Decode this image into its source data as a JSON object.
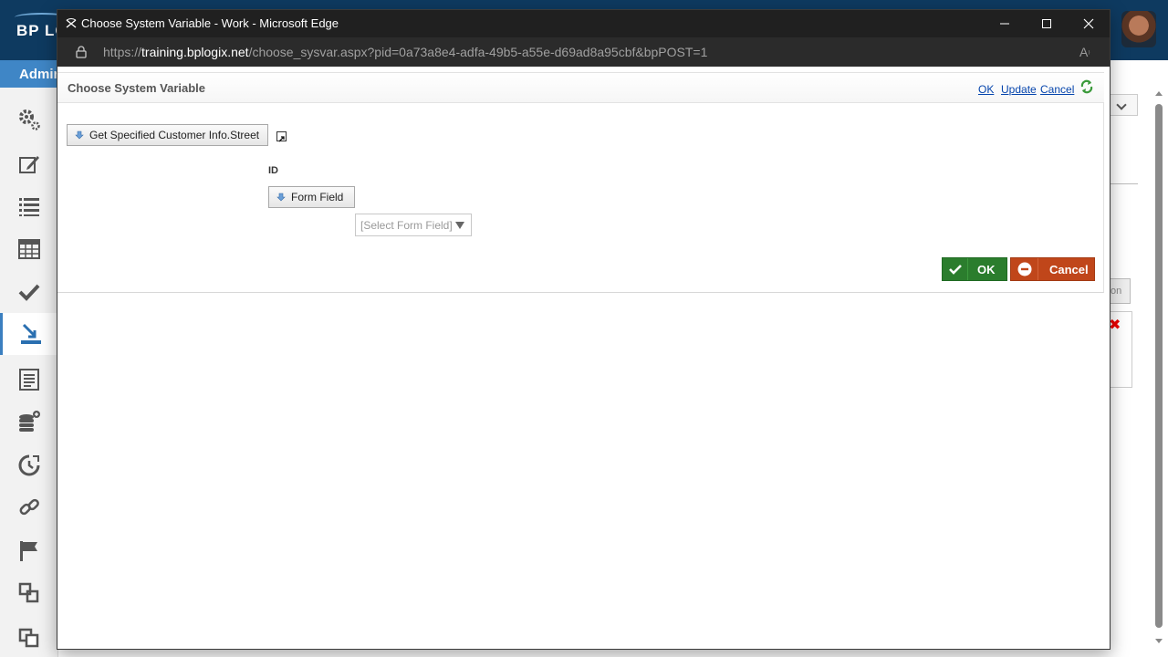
{
  "app": {
    "logo_text": "BP LO",
    "admin_tab_label": "Admir"
  },
  "sidebar": {
    "items": [
      {
        "icon": "gears-icon"
      },
      {
        "icon": "edit-icon"
      },
      {
        "icon": "list-icon"
      },
      {
        "icon": "table-icon"
      },
      {
        "icon": "check-icon"
      },
      {
        "icon": "import-icon",
        "active": true
      },
      {
        "icon": "report-icon"
      },
      {
        "icon": "database-add-icon"
      },
      {
        "icon": "timer-icon"
      },
      {
        "icon": "link-icon"
      },
      {
        "icon": "flag-icon"
      },
      {
        "icon": "copy-icon"
      },
      {
        "icon": "layers-icon"
      }
    ]
  },
  "background": {
    "partial_button_text": "on"
  },
  "window": {
    "title": "Choose System Variable - Work - Microsoft Edge",
    "url_prefix": "https://",
    "url_domain": "training.bplogix.net",
    "url_path": "/choose_sysvar.aspx?pid=0a73a8e4-adfa-49b5-a55e-d69ad8a95cbf&bpPOST=1"
  },
  "dialog": {
    "title": "Choose System Variable",
    "header_links": {
      "ok": "OK",
      "update": "Update",
      "cancel": "Cancel"
    },
    "variable_button": "Get Specified Customer Info.Street",
    "id_label": "ID",
    "form_field_button": "Form Field",
    "select_placeholder": "[Select Form Field]",
    "ok_button": "OK",
    "cancel_button": "Cancel"
  },
  "colors": {
    "ok_green": "#2b7d2d",
    "cancel_orange": "#c0461a",
    "link_blue": "#0645ad",
    "header_navy": "#0e3a60"
  }
}
